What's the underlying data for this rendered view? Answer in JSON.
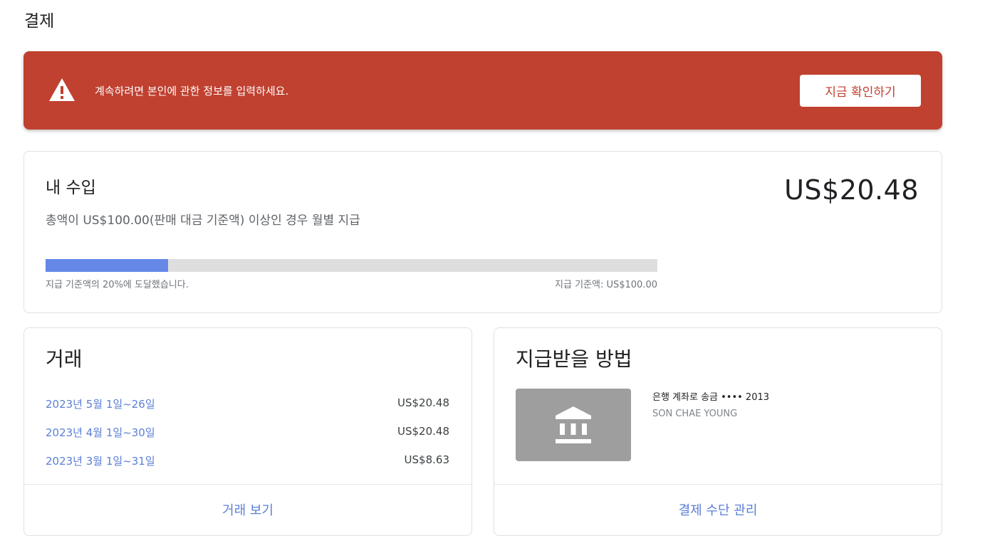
{
  "page": {
    "title": "결제"
  },
  "alert": {
    "icon": "warning-triangle-icon",
    "message": "계속하려면 본인에 관한 정보를 입력하세요.",
    "button_label": "지금 확인하기",
    "background_color": "#c04130"
  },
  "earnings": {
    "title": "내 수입",
    "subtitle": "총액이 US$100.00(판매 대금 기준액) 이상인 경우 월별 지급",
    "amount": "US$20.48",
    "progress": {
      "percent": 20,
      "left_label": "지급 기준액의 20%에 도달했습니다.",
      "right_label": "지급 기준액: US$100.00",
      "fill_color": "#6588e8"
    }
  },
  "transactions": {
    "title": "거래",
    "rows": [
      {
        "period": "2023년 5월 1일~26일",
        "amount": "US$20.48"
      },
      {
        "period": "2023년 4월 1일~30일",
        "amount": "US$20.48"
      },
      {
        "period": "2023년 3월 1일~31일",
        "amount": "US$8.63"
      }
    ],
    "footer_link": "거래 보기"
  },
  "payment_method": {
    "title": "지급받을 방법",
    "icon": "bank-icon",
    "line1": "은행 계좌로 송금 •••• 2013",
    "line2": "SON CHAE YOUNG",
    "footer_link": "결제 수단 관리"
  },
  "colors": {
    "link": "#5b7fd6"
  }
}
